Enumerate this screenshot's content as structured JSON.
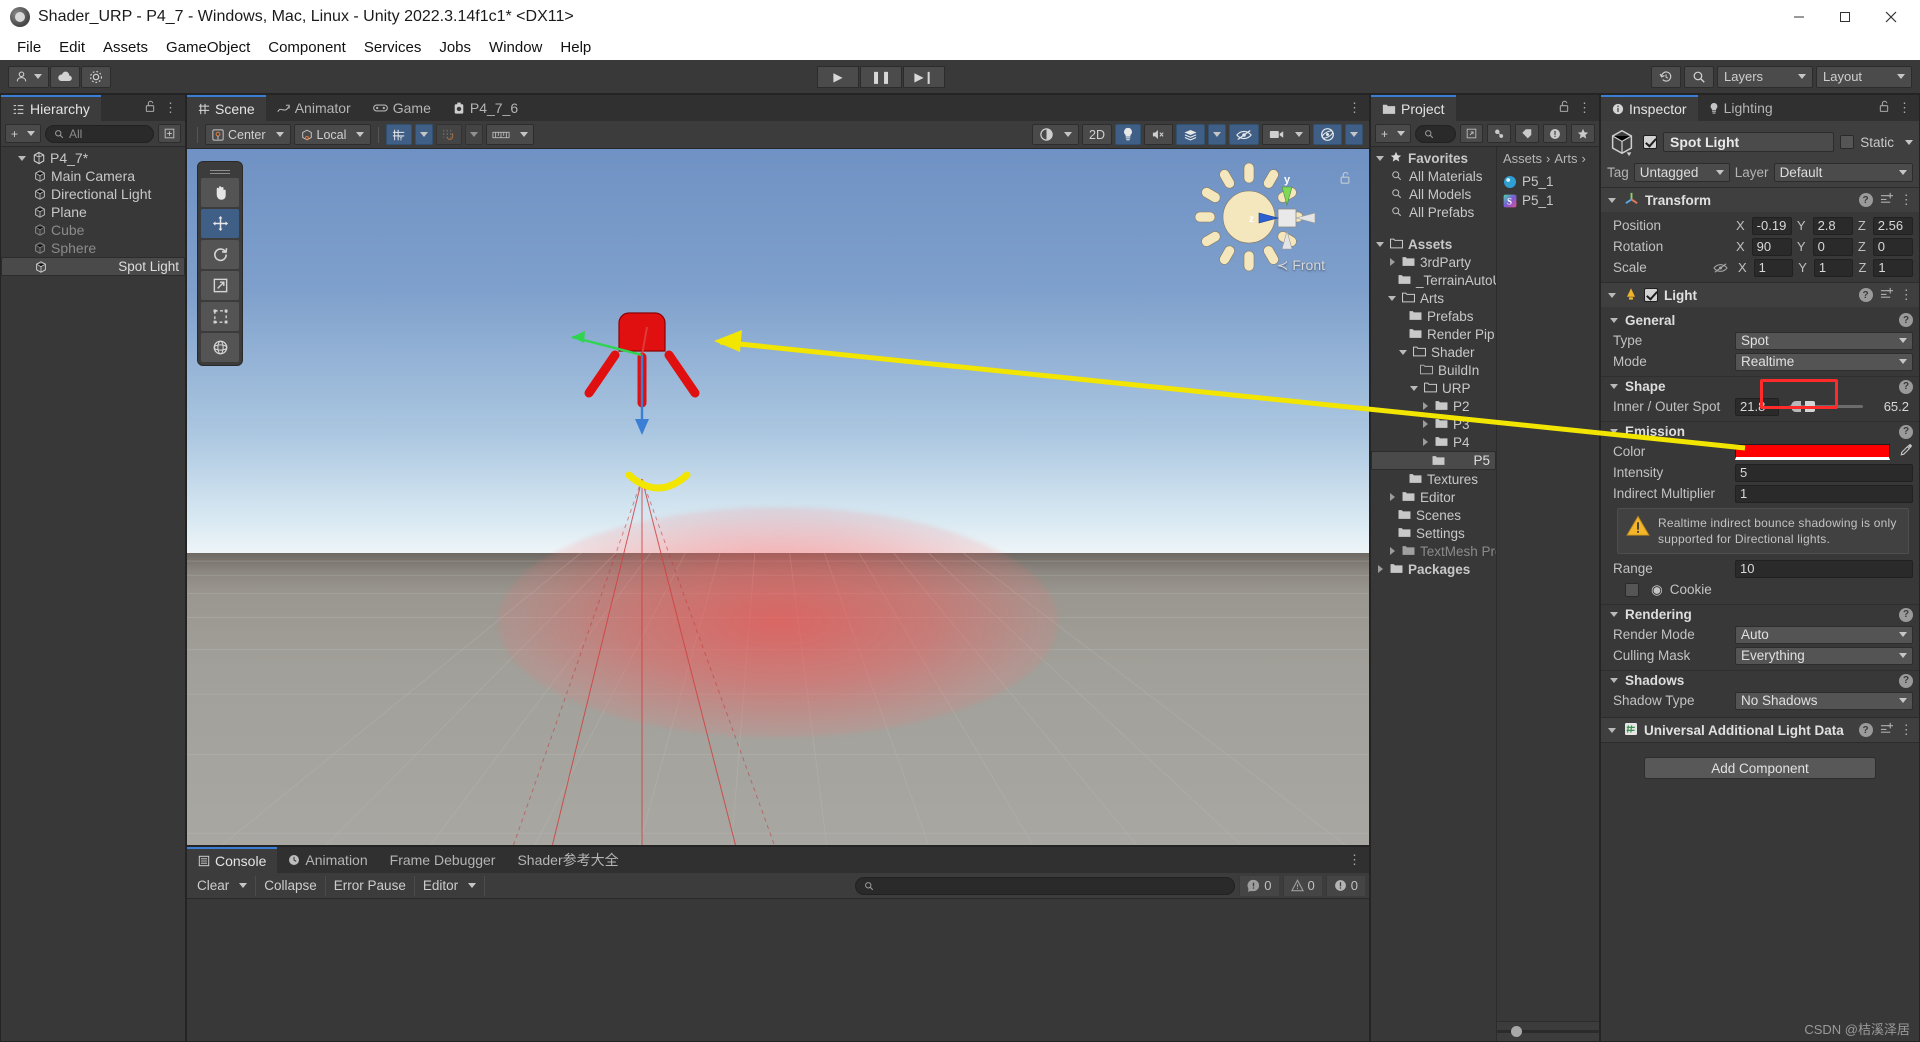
{
  "window": {
    "title": "Shader_URP - P4_7 - Windows, Mac, Linux - Unity 2022.3.14f1c1* <DX11>",
    "minimize": "─",
    "maximize": "☐",
    "close": "✕"
  },
  "menu": [
    "File",
    "Edit",
    "Assets",
    "GameObject",
    "Component",
    "Services",
    "Jobs",
    "Window",
    "Help"
  ],
  "toolbar": {
    "account_icon": "account-icon",
    "cloud_icon": "cloud-icon",
    "settings_icon": "gear-icon",
    "play": "▶",
    "pause": "❚❚",
    "step": "▶❙",
    "history_icon": "undo-history-icon",
    "search_icon": "search-icon",
    "layers": "Layers",
    "layout": "Layout"
  },
  "hierarchy": {
    "tab": "Hierarchy",
    "add_label": "+",
    "search_placeholder": "All",
    "items": [
      {
        "label": "P4_7*",
        "depth": 0,
        "expanded": true,
        "icon": "unity-logo-icon",
        "selected": false,
        "dim": false
      },
      {
        "label": "Main Camera",
        "depth": 1,
        "expanded": false,
        "icon": "gameobject-icon",
        "selected": false,
        "dim": false
      },
      {
        "label": "Directional Light",
        "depth": 1,
        "expanded": false,
        "icon": "gameobject-icon",
        "selected": false,
        "dim": false
      },
      {
        "label": "Plane",
        "depth": 1,
        "expanded": false,
        "icon": "gameobject-icon",
        "selected": false,
        "dim": false
      },
      {
        "label": "Cube",
        "depth": 1,
        "expanded": false,
        "icon": "gameobject-icon",
        "selected": false,
        "dim": true
      },
      {
        "label": "Sphere",
        "depth": 1,
        "expanded": false,
        "icon": "gameobject-icon",
        "selected": false,
        "dim": true
      },
      {
        "label": "Spot Light",
        "depth": 1,
        "expanded": false,
        "icon": "gameobject-icon",
        "selected": true,
        "dim": false
      }
    ]
  },
  "scene": {
    "tabs": [
      {
        "label": "Scene",
        "icon": "grid-icon",
        "active": true
      },
      {
        "label": "Animator",
        "icon": "animator-icon",
        "active": false
      },
      {
        "label": "Game",
        "icon": "gamepad-icon",
        "active": false
      },
      {
        "label": "P4_7_6",
        "icon": "shader-graph-icon",
        "active": false
      }
    ],
    "toolbar": {
      "pivot": "Center",
      "space": "Local",
      "grid_snap_icon": "grid-snap-icon",
      "magnet_icon": "magnet-snap-icon",
      "ruler_icon": "ruler-icon",
      "shading": "shaded-mode-icon",
      "two_d": "2D",
      "lighting_icon": "light-bulb-icon",
      "audio_icon": "audio-mute-icon",
      "fx_icon": "effects-icon",
      "hidden_icon": "hidden-objects-icon",
      "camera_icon": "scene-camera-icon",
      "gizmos_icon": "gizmos-icon"
    },
    "tools": [
      "hand-tool",
      "move-tool",
      "rotate-tool",
      "scale-tool",
      "rect-tool",
      "transform-tool"
    ],
    "active_tool": "move-tool",
    "gizmo": {
      "x_label": "x",
      "y_label": "y",
      "z_label": "z",
      "front": "Front",
      "lock_icon": "lock-open-icon"
    }
  },
  "console": {
    "tabs": [
      {
        "label": "Console",
        "icon": "console-icon",
        "active": true
      },
      {
        "label": "Animation",
        "icon": "clock-icon",
        "active": false
      },
      {
        "label": "Frame Debugger",
        "icon": "",
        "active": false
      },
      {
        "label": "Shader参考大全",
        "icon": "",
        "active": false
      }
    ],
    "buttons": [
      "Clear",
      "Collapse",
      "Error Pause",
      "Editor"
    ],
    "search_placeholder": "",
    "counts": {
      "log": "0",
      "warning": "0",
      "error": "0"
    }
  },
  "project": {
    "tab": "Project",
    "add_label": "+",
    "search_placeholder": "",
    "tree": [
      {
        "label": "Favorites",
        "depth": 0,
        "arrow": "down",
        "icon": "star-icon",
        "bold": true
      },
      {
        "label": "All Materials",
        "depth": 1,
        "arrow": "none",
        "icon": "search-icon",
        "bold": false
      },
      {
        "label": "All Models",
        "depth": 1,
        "arrow": "none",
        "icon": "search-icon",
        "bold": false
      },
      {
        "label": "All Prefabs",
        "depth": 1,
        "arrow": "none",
        "icon": "search-icon",
        "bold": false
      },
      {
        "label": "",
        "depth": 0,
        "arrow": "none",
        "icon": "",
        "bold": false
      },
      {
        "label": "Assets",
        "depth": 0,
        "arrow": "down",
        "icon": "folder-open-icon",
        "bold": true
      },
      {
        "label": "3rdParty",
        "depth": 1,
        "arrow": "right",
        "icon": "folder-icon",
        "bold": false
      },
      {
        "label": "_TerrainAutoU",
        "depth": 1,
        "arrow": "none",
        "icon": "folder-icon",
        "bold": false
      },
      {
        "label": "Arts",
        "depth": 1,
        "arrow": "down",
        "icon": "folder-open-icon",
        "bold": false
      },
      {
        "label": "Prefabs",
        "depth": 2,
        "arrow": "none",
        "icon": "folder-icon",
        "bold": false
      },
      {
        "label": "Render Pip",
        "depth": 2,
        "arrow": "none",
        "icon": "folder-icon",
        "bold": false
      },
      {
        "label": "Shader",
        "depth": 2,
        "arrow": "down",
        "icon": "folder-open-icon",
        "bold": false
      },
      {
        "label": "BuildIn",
        "depth": 3,
        "arrow": "none",
        "icon": "folder-empty-icon",
        "bold": false
      },
      {
        "label": "URP",
        "depth": 3,
        "arrow": "down",
        "icon": "folder-open-icon",
        "bold": false
      },
      {
        "label": "P2",
        "depth": 4,
        "arrow": "right",
        "icon": "folder-icon",
        "bold": false
      },
      {
        "label": "P3",
        "depth": 4,
        "arrow": "right",
        "icon": "folder-icon",
        "bold": false
      },
      {
        "label": "P4",
        "depth": 4,
        "arrow": "right",
        "icon": "folder-icon",
        "bold": false
      },
      {
        "label": "P5",
        "depth": 4,
        "arrow": "none",
        "icon": "folder-icon",
        "bold": false,
        "selected": true
      },
      {
        "label": "Textures",
        "depth": 2,
        "arrow": "none",
        "icon": "folder-icon",
        "bold": false
      },
      {
        "label": "Editor",
        "depth": 1,
        "arrow": "right",
        "icon": "folder-icon",
        "bold": false
      },
      {
        "label": "Scenes",
        "depth": 1,
        "arrow": "none",
        "icon": "folder-icon",
        "bold": false
      },
      {
        "label": "Settings",
        "depth": 1,
        "arrow": "none",
        "icon": "folder-icon",
        "bold": false
      },
      {
        "label": "TextMesh Pro",
        "depth": 1,
        "arrow": "right",
        "icon": "folder-icon",
        "bold": false,
        "dim": true
      },
      {
        "label": "Packages",
        "depth": 0,
        "arrow": "right",
        "icon": "folder-icon",
        "bold": true
      }
    ],
    "breadcrumb": [
      "Assets",
      "Arts"
    ],
    "assets": [
      {
        "label": "P5_1",
        "icon": "material-icon"
      },
      {
        "label": "P5_1",
        "icon": "shader-icon"
      }
    ]
  },
  "inspector": {
    "tabs": [
      {
        "label": "Inspector",
        "icon": "info-icon",
        "active": true
      },
      {
        "label": "Lighting",
        "icon": "light-bulb-icon",
        "active": false
      }
    ],
    "object": {
      "name": "Spot Light",
      "enabled": true,
      "static_label": "Static",
      "static_checked": false,
      "tag_label": "Tag",
      "tag_value": "Untagged",
      "layer_label": "Layer",
      "layer_value": "Default"
    },
    "transform": {
      "title": "Transform",
      "position": {
        "label": "Position",
        "x": "-0.19",
        "y": "2.8",
        "z": "2.56"
      },
      "rotation": {
        "label": "Rotation",
        "x": "90",
        "y": "0",
        "z": "0"
      },
      "scale": {
        "label": "Scale",
        "x": "1",
        "y": "1",
        "z": "1"
      }
    },
    "light": {
      "title": "Light",
      "enabled": true,
      "general": {
        "title": "General",
        "type_label": "Type",
        "type_value": "Spot",
        "mode_label": "Mode",
        "mode_value": "Realtime"
      },
      "shape": {
        "title": "Shape",
        "spot_angle_label": "Inner / Outer Spot",
        "inner_value": "21.8",
        "outer_value": "65.2",
        "highlight_color": "#ff2b2b"
      },
      "emission": {
        "title": "Emission",
        "color_label": "Color",
        "color_value": "#ff0000",
        "intensity_label": "Intensity",
        "intensity_value": "5",
        "indirect_label": "Indirect Multiplier",
        "indirect_value": "1",
        "warning": "Realtime indirect bounce shadowing is only supported for Directional lights.",
        "range_label": "Range",
        "range_value": "10",
        "cookie_label": "Cookie",
        "cookie_checked": false
      },
      "rendering": {
        "title": "Rendering",
        "render_mode_label": "Render Mode",
        "render_mode_value": "Auto",
        "culling_label": "Culling Mask",
        "culling_value": "Everything"
      },
      "shadows": {
        "title": "Shadows",
        "shadow_type_label": "Shadow Type",
        "shadow_type_value": "No Shadows"
      }
    },
    "urp_component": {
      "title": "Universal Additional Light Data"
    },
    "add_component": "Add Component"
  },
  "watermark": "CSDN @桔溪泽居",
  "colors": {
    "accent_blue": "#3b7fd4",
    "highlight_red": "#ff2b2b",
    "light_red": "#ff0000",
    "annotation_yellow": "#f2e500",
    "panel_bg": "#383838",
    "header_bg": "#3f3f3f"
  }
}
